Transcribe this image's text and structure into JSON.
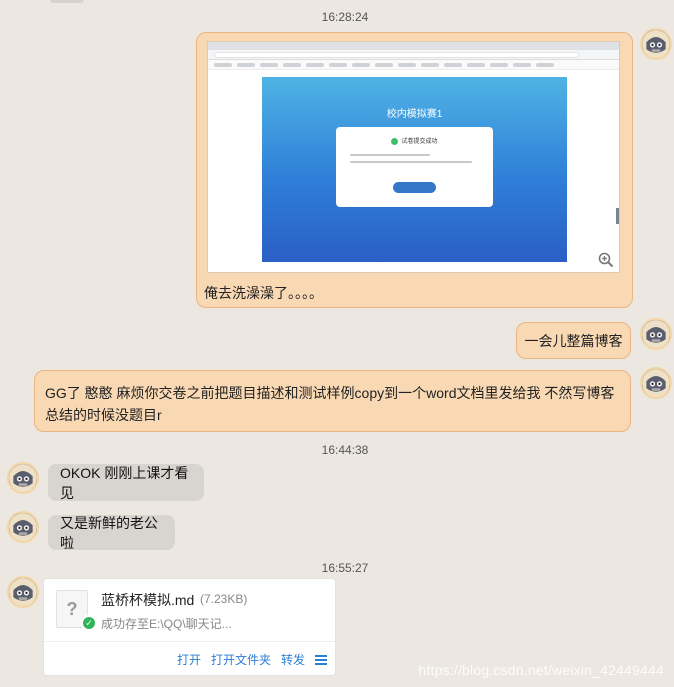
{
  "timestamps": [
    "16:28:24",
    "16:44:38",
    "16:55:27"
  ],
  "messages": {
    "m1_caption": "俺去洗澡澡了。。。。",
    "m2_text": "一会儿整篇博客",
    "m3_text": "GG了 憨憨 麻烦你交卷之前把题目描述和测试样例copy到一个word文档里发给我 不然写博客总结的时候没题目r",
    "m4_text": "OKOK 刚刚上课才看见",
    "m5_text": "又是新鲜的老公啦"
  },
  "screenshot": {
    "contest_title": "校内模拟赛1",
    "card_status": "试卷提交成功"
  },
  "file": {
    "name": "蓝桥杯模拟.md",
    "size": "(7.23KB)",
    "status": "成功存至E:\\QQ\\聊天记...",
    "actions": [
      "打开",
      "打开文件夹",
      "转发"
    ],
    "icon": "question-mark-file-icon"
  },
  "watermark": "https://blog.csdn.net/weixin_42449444",
  "colors": {
    "background": "#ede7e1",
    "bubble_orange": "#f9d9b4",
    "bubble_gray": "#d8d4d0",
    "link_blue": "#2b7fd4"
  }
}
